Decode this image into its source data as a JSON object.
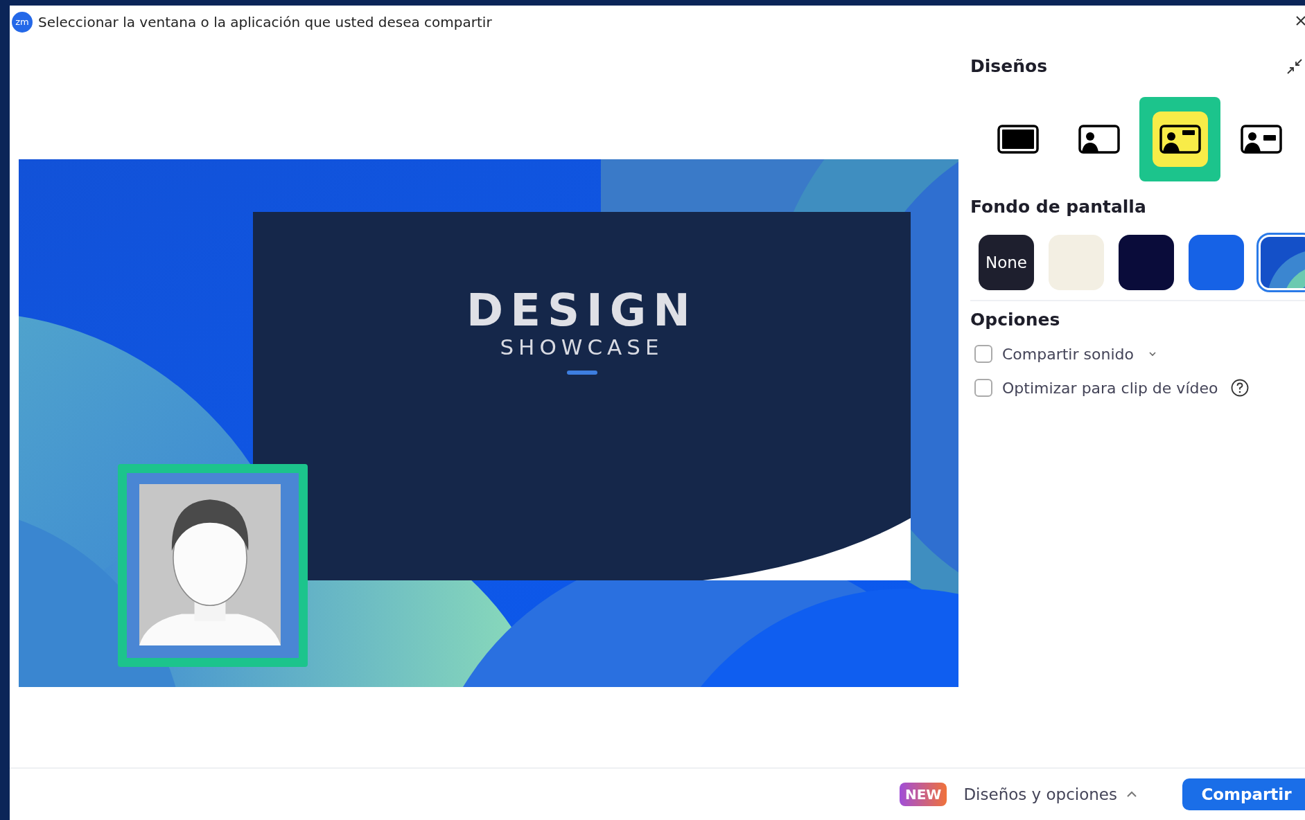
{
  "window": {
    "app_badge": "zm",
    "title": "Seleccionar la ventana o la aplicación que usted desea compartir"
  },
  "preview": {
    "slide": {
      "title": "DESIGN",
      "subtitle": "SHOWCASE"
    },
    "camera": {
      "kind": "picture"
    }
  },
  "panel": {
    "layouts_title": "Diseños",
    "layouts": [
      {
        "kind": "screen",
        "selected": false
      },
      {
        "kind": "pip",
        "selected": false
      },
      {
        "kind": "pip_card",
        "selected": true
      },
      {
        "kind": "side",
        "selected": false
      }
    ],
    "background_title": "Fondo de pantalla",
    "backgrounds": [
      {
        "kind": "none",
        "label": "None",
        "selected": false
      },
      {
        "kind": "color",
        "color": "#f3efe3",
        "selected": false
      },
      {
        "kind": "color",
        "color": "#0a0c3a",
        "selected": false
      },
      {
        "kind": "color",
        "color": "#1662e6",
        "selected": false
      },
      {
        "kind": "picture",
        "selected": true
      }
    ],
    "options_title": "Opciones",
    "options": [
      {
        "kind": "dropdown",
        "label": "Compartir sonido",
        "checked": false
      },
      {
        "kind": "help",
        "label": "Optimizar para clip de vídeo",
        "checked": false
      }
    ]
  },
  "footer": {
    "badge": "NEW",
    "menu": "Diseños y opciones",
    "expanded": true,
    "button": "Compartir"
  }
}
